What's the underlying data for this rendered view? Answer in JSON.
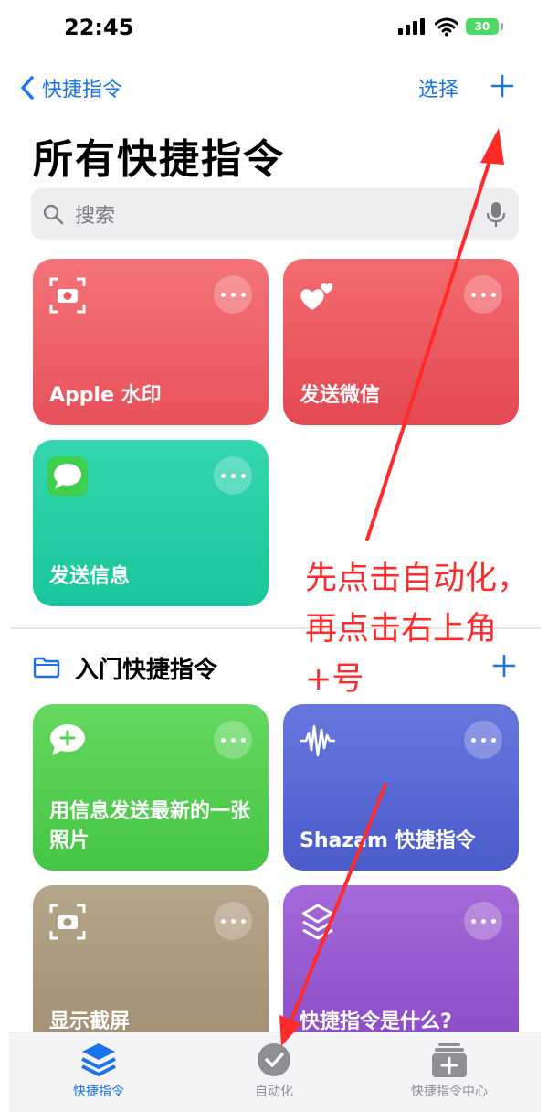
{
  "status_bar": {
    "time": "22:45",
    "battery": "30"
  },
  "nav": {
    "back_label": "快捷指令",
    "select_label": "选择"
  },
  "page_title": "所有快捷指令",
  "search": {
    "placeholder": "搜索"
  },
  "shortcuts": [
    {
      "title": "Apple 水印",
      "icon": "camera-viewfinder-icon",
      "color": "#ee5d66"
    },
    {
      "title": "发送微信",
      "icon": "hearts-icon",
      "color": "#ec5962"
    },
    {
      "title": "发送信息",
      "icon": "messages-app-icon",
      "color": "#22ceA3"
    }
  ],
  "section": {
    "title": "入门快捷指令",
    "items": [
      {
        "title": "用信息发送最新的一张照片",
        "icon": "message-plus-icon",
        "color": "#55cf52"
      },
      {
        "title": "Shazam 快捷指令",
        "icon": "waveform-icon",
        "color": "#5868d4"
      },
      {
        "title": "显示截屏",
        "icon": "camera-viewfinder-icon",
        "color": "#ab9a7e"
      },
      {
        "title": "快捷指令是什么?",
        "icon": "shortcuts-logo-icon",
        "color": "#985ad0"
      }
    ]
  },
  "annotation": "先点击自动化，再点击右上角+号",
  "tabs": [
    {
      "label": "快捷指令",
      "icon": "layers-icon",
      "active": true,
      "color": "#1a73e8"
    },
    {
      "label": "自动化",
      "icon": "clock-check-icon",
      "active": false,
      "color": "#8e8e93"
    },
    {
      "label": "快捷指令中心",
      "icon": "gallery-icon",
      "active": false,
      "color": "#8e8e93"
    }
  ],
  "colors": {
    "accent": "#1a73e8",
    "annotation": "#ff2a2a"
  }
}
